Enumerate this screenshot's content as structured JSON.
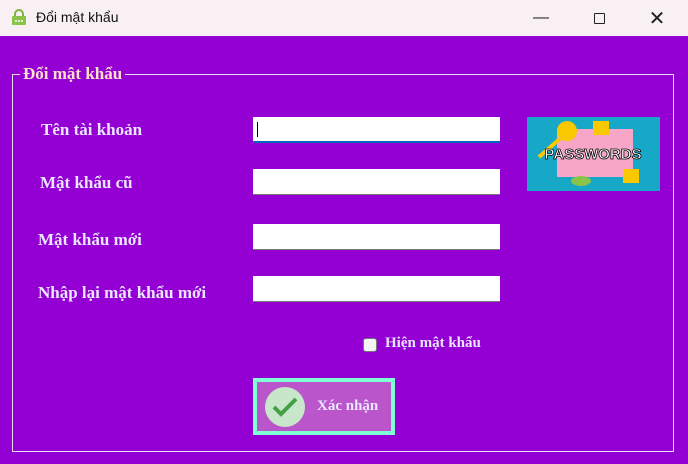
{
  "window": {
    "title": "Đổi mật khẩu"
  },
  "group": {
    "title": "Đổi mật khẩu"
  },
  "fields": [
    {
      "label": "Tên tài khoản",
      "value": ""
    },
    {
      "label": "Mật khẩu cũ",
      "value": ""
    },
    {
      "label": "Mật khẩu mới",
      "value": ""
    },
    {
      "label": "Nhập lại mật khẩu mới",
      "value": ""
    }
  ],
  "image": {
    "text": "PASSWORDS"
  },
  "show_password": {
    "label": "Hiện mật khẩu",
    "checked": false
  },
  "submit": {
    "label": "Xác nhận"
  }
}
